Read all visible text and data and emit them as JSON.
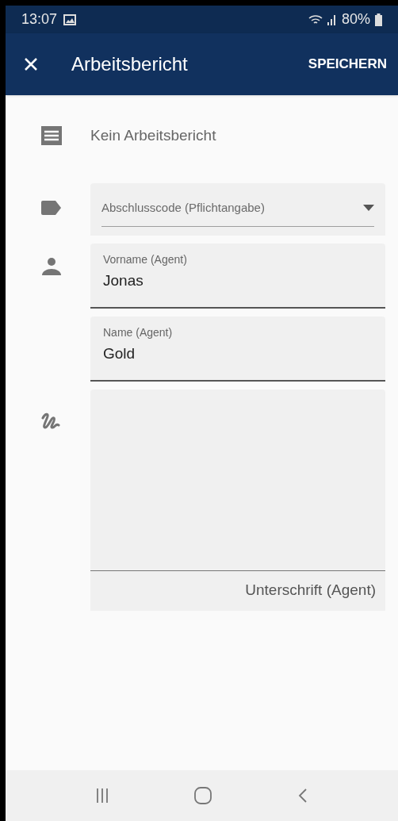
{
  "status_bar": {
    "time": "13:07",
    "battery": "80%"
  },
  "app_bar": {
    "title": "Arbeitsbericht",
    "action": "SPEICHERN"
  },
  "report": {
    "text": "Kein Arbeitsbericht"
  },
  "fields": [
    {
      "kind": "dropdown",
      "placeholder": "Abschlusscode (Pflichtangabe)"
    },
    {
      "kind": "text",
      "label": "Vorname (Agent)",
      "value": "Jonas"
    },
    {
      "kind": "text",
      "label": "Name (Agent)",
      "value": "Gold"
    },
    {
      "kind": "signature",
      "label": "Unterschrift (Agent)"
    }
  ]
}
